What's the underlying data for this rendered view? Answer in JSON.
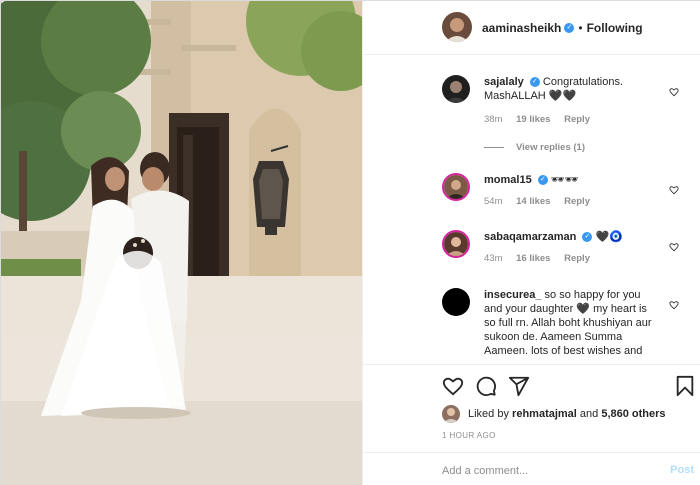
{
  "post": {
    "owner": "aaminasheikh",
    "follow_state": "Following",
    "separator": "•"
  },
  "comments": [
    {
      "user": "sajalaly",
      "verified": true,
      "text": "Congratulations. MashALLAH 🖤🖤",
      "time": "38m",
      "likes": "19 likes",
      "reply_label": "Reply",
      "view_replies": "View replies (1)"
    },
    {
      "user": "momal15",
      "verified": true,
      "text": "🕶🕶",
      "time": "54m",
      "likes": "14 likes",
      "reply_label": "Reply"
    },
    {
      "user": "sabaqamarzaman",
      "verified": true,
      "text": "🖤🧿",
      "time": "43m",
      "likes": "16 likes",
      "reply_label": "Reply"
    },
    {
      "user": "insecurea_",
      "verified": false,
      "text": "so so happy for you and your daughter 🖤 my heart is so full rn. Allah boht khushiyan aur sukoon de. Aameen Summa Aameen. lots of best wishes and"
    }
  ],
  "likes": {
    "prefix": "Liked by",
    "user": "rehmatajmal",
    "and": "and",
    "others": "5,860 others"
  },
  "timestamp": "1 HOUR AGO",
  "comment_box": {
    "placeholder": "Add a comment...",
    "post_label": "Post"
  },
  "colors": {
    "verified": "#3897f0",
    "post_disabled": "#b2dffc",
    "meta_gray": "#8e8e8e"
  },
  "icons": [
    "heart-icon",
    "comment-icon",
    "share-icon",
    "bookmark-icon",
    "small-heart-icon",
    "verified-icon"
  ]
}
